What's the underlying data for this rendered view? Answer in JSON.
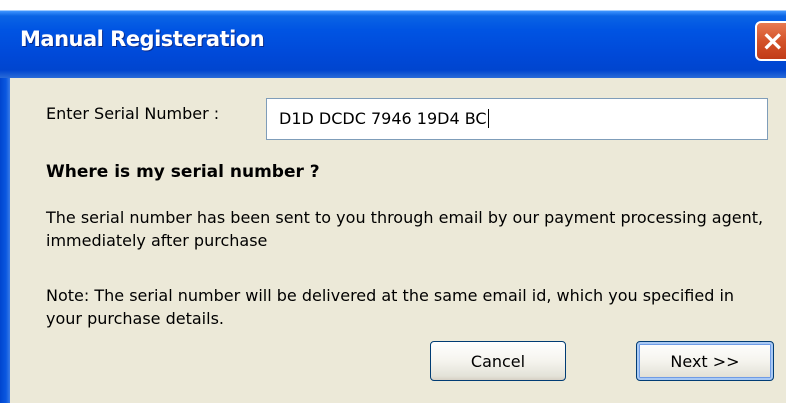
{
  "window": {
    "title": "Manual Registeration",
    "close_icon": "×"
  },
  "form": {
    "serial_label": "Enter Serial Number :",
    "serial_value": "D1D DCDC 7946 19D4 BC"
  },
  "help": {
    "heading": "Where is my serial number ?",
    "paragraph1": "The serial number has been sent to you through email by our payment processing agent, immediately after purchase",
    "paragraph2": "Note: The serial number will be delivered at the same email id, which you specified in your purchase details."
  },
  "buttons": {
    "cancel": "Cancel",
    "next": "Next >>"
  },
  "icons": {
    "close": "close-icon"
  }
}
